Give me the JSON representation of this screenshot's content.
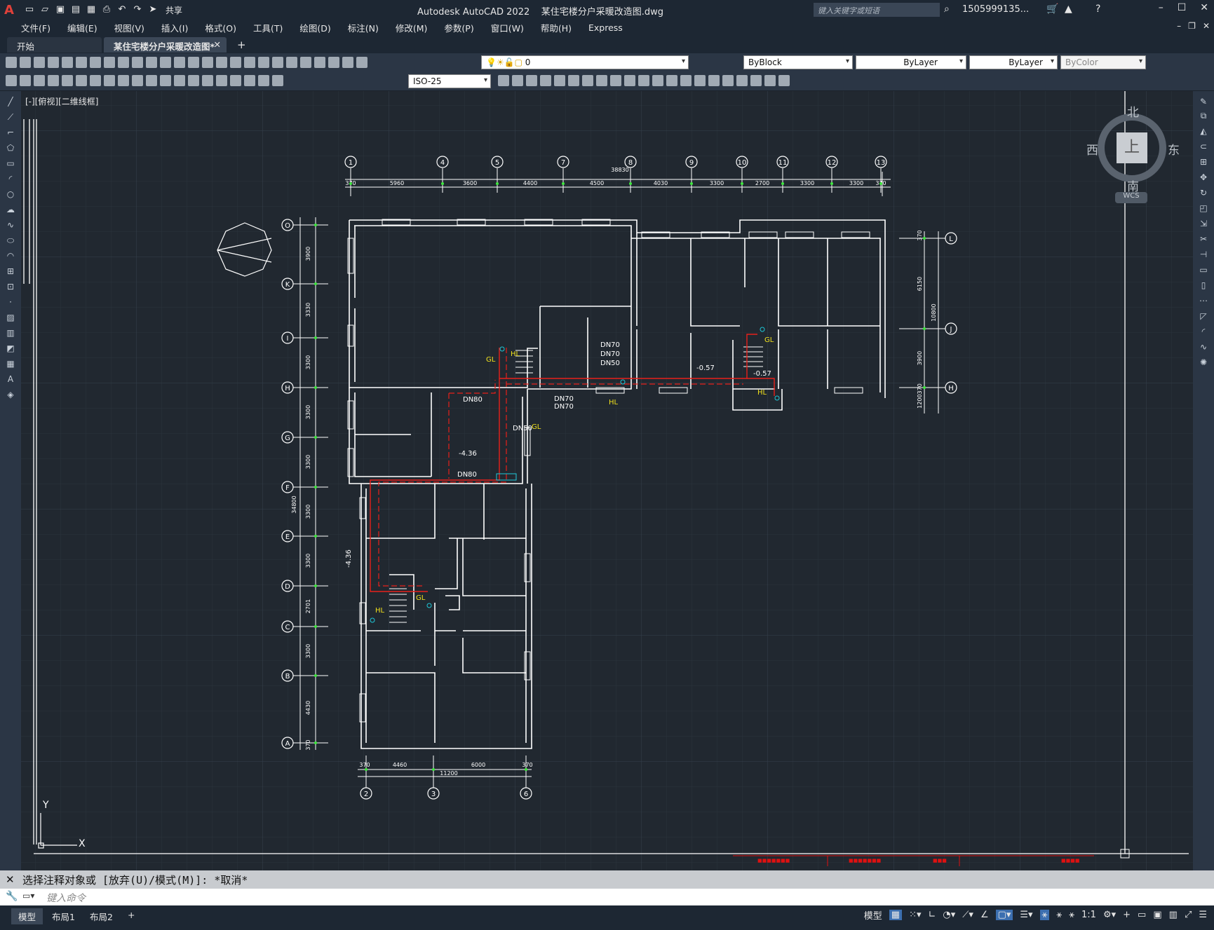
{
  "app": {
    "title": "Autodesk AutoCAD 2022    某住宅楼分户采暖改造图.dwg",
    "search_placeholder": "键入关键字或短语",
    "user": "1505999135...",
    "share_label": "共享",
    "window_buttons": [
      "–",
      "☐",
      "✕"
    ]
  },
  "menu": {
    "items": [
      "文件(F)",
      "编辑(E)",
      "视图(V)",
      "插入(I)",
      "格式(O)",
      "工具(T)",
      "绘图(D)",
      "标注(N)",
      "修改(M)",
      "参数(P)",
      "窗口(W)",
      "帮助(H)",
      "Express"
    ]
  },
  "tabs": {
    "start": "开始",
    "drawing": "某住宅楼分户采暖改造图*",
    "close": "✕",
    "plus": "+"
  },
  "toolbar": {
    "layer_value": "0",
    "color_value": "ByBlock",
    "linetype_value": "ByLayer",
    "lineweight_value": "ByLayer",
    "plotstyle_value": "ByColor",
    "dimstyle_value": "ISO-25"
  },
  "viewport": {
    "label": "[-][俯视][二维线框]",
    "viewcube": {
      "north": "北",
      "south": "南",
      "east": "东",
      "west": "西",
      "top": "上",
      "wcs": "WCS"
    },
    "ucs": {
      "x": "X",
      "y": "Y"
    }
  },
  "drawing": {
    "top_axes": [
      "1",
      "4",
      "5",
      "7",
      "8",
      "9",
      "10",
      "11",
      "12",
      "13"
    ],
    "top_dims": [
      "370",
      "5960",
      "3600",
      "4400",
      "4500",
      "4030",
      "3300",
      "2700",
      "3300",
      "3300",
      "370"
    ],
    "top_total": "38830",
    "left_axes": [
      "O",
      "K",
      "I",
      "H",
      "G",
      "F",
      "E",
      "D",
      "C",
      "B",
      "A"
    ],
    "left_dims": [
      "3900",
      "3330",
      "3300",
      "3300",
      "3300",
      "3300",
      "3300",
      "2701",
      "3300",
      "4430",
      "370"
    ],
    "left_total": "34800",
    "right_axes": [
      "L",
      "J",
      "H"
    ],
    "right_dims": [
      "370",
      "6150",
      "3900",
      "1200370"
    ],
    "right_total": "10800",
    "bottom_axes": [
      "2",
      "3",
      "6"
    ],
    "bottom_dims": [
      "370",
      "4460",
      "6000",
      "370"
    ],
    "bottom_total": "11200",
    "labels": {
      "dn70a": "DN70",
      "dn70b": "DN70",
      "dn50a": "DN50",
      "dn80a": "DN80",
      "dn80b": "DN80",
      "dn70c": "DN70",
      "dn70d": "DN70",
      "dn50b": "DN50",
      "gl1": "GL",
      "gl2": "GL",
      "gl3": "GL",
      "gl4": "GL",
      "hl1": "HL",
      "hl2": "HL",
      "hl3": "HL",
      "hl4": "HL",
      "el1": "-0.57",
      "el2": "-0.57",
      "el3": "-4.36",
      "el4": "-4.36"
    }
  },
  "command": {
    "history": "选择注释对象或 [放弃(U)/模式(M)]: *取消*",
    "placeholder": "键入命令"
  },
  "status": {
    "layouts": [
      "模型",
      "布局1",
      "布局2"
    ],
    "plus": "+",
    "model_button": "模型",
    "scale": "1:1"
  }
}
